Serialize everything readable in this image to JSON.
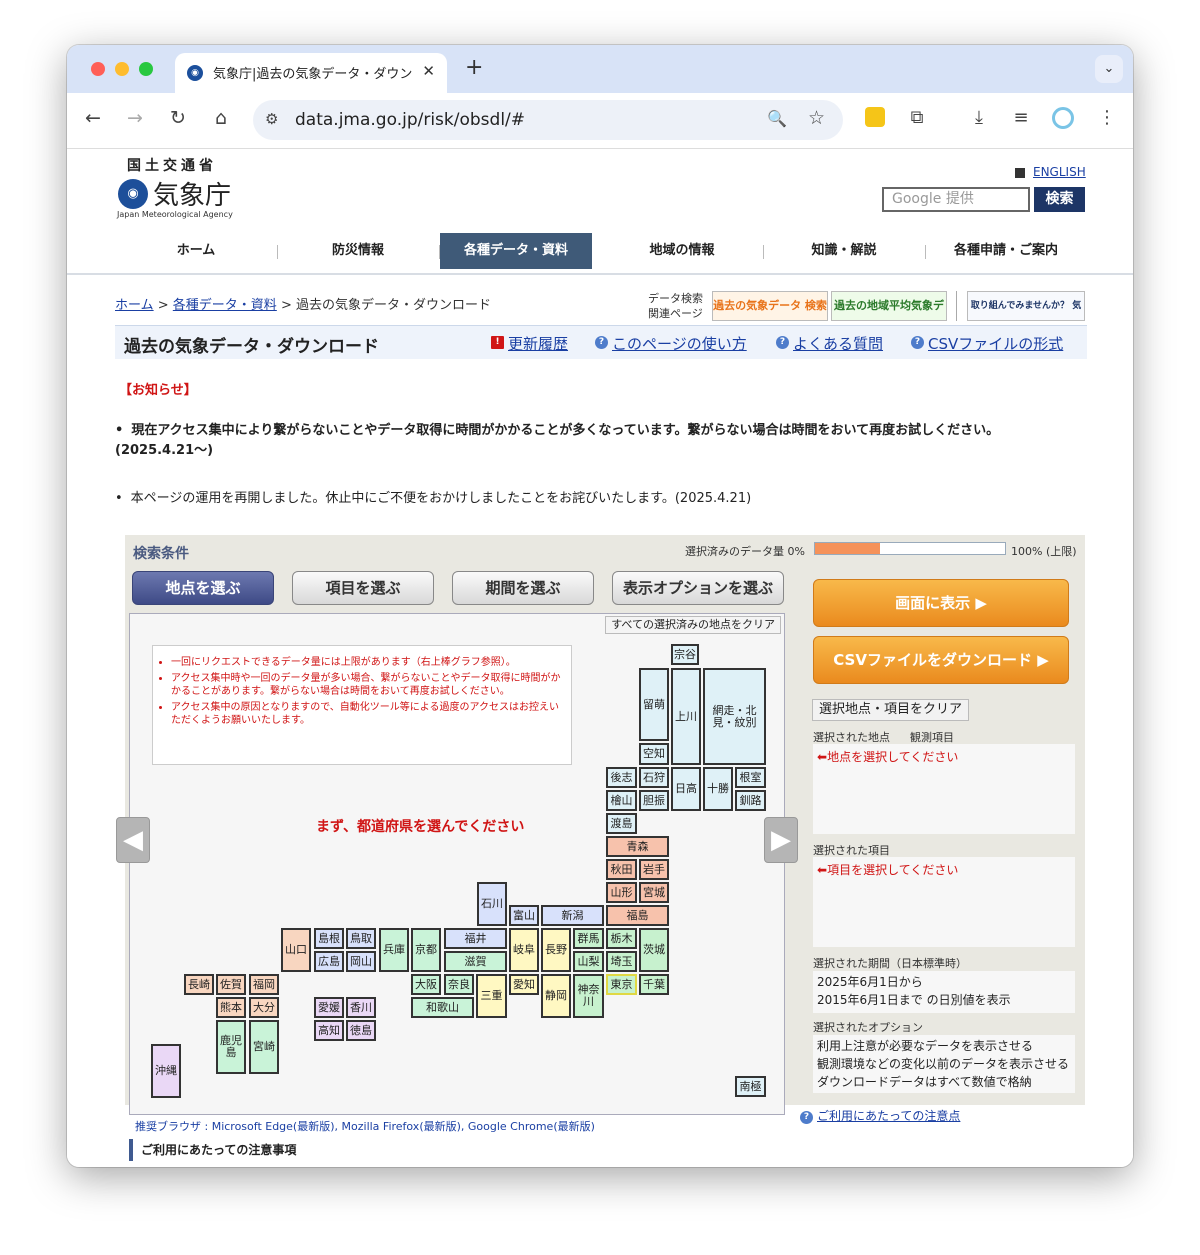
{
  "browser": {
    "tab_title": "気象庁|過去の気象データ・ダウン",
    "tab_close": "✕",
    "new_tab": "+",
    "url": "data.jma.go.jp/risk/obsdl/#"
  },
  "header": {
    "ministry": "国土交通省",
    "agency": "気象庁",
    "agency_en": "Japan Meteorological Agency",
    "english": "ENGLISH",
    "search_placeholder": "Google 提供",
    "search_button": "検索"
  },
  "nav": [
    "ホーム",
    "防災情報",
    "各種データ・資料",
    "地域の情報",
    "知識・解説",
    "各種申請・ご案内"
  ],
  "breadcrumb": {
    "home": "ホーム",
    "data": "各種データ・資料",
    "sep": " > ",
    "current": "過去の気象データ・ダウンロード"
  },
  "related": {
    "label1": "データ検索",
    "label2": "関連ページ",
    "banner1": "過去の気象データ 検索",
    "banner2": "過去の地域平均気象データ 検索",
    "banner3": "取り組んでみませんか？ 気候リスク管理"
  },
  "title": {
    "text": "過去の気象データ・ダウンロード",
    "links": [
      "更新履歴",
      "このページの使い方",
      "よくある質問",
      "CSVファイルの形式"
    ]
  },
  "notice": {
    "heading": "【お知らせ】",
    "item1": "現在アクセス集中により繋がらないことやデータ取得に時間がかかることが多くなっています。繋がらない場合は時間をおいて再度お試しください。(2025.4.21〜)",
    "item2": "本ページの運用を再開しました。休止中にご不便をおかけしましたことをお詫びいたします。(2025.4.21)"
  },
  "search": {
    "title": "検索条件",
    "data_label": "選択済みのデータ量 0%",
    "data_max": "100% (上限)",
    "data_fraction": 0.34,
    "tabs": [
      "地点を選ぶ",
      "項目を選ぶ",
      "期間を選ぶ",
      "表示オプションを選ぶ"
    ],
    "clear_all": "すべての選択済みの地点をクリア",
    "warnings": [
      "一回にリクエストできるデータ量には上限があります（右上棒グラフ参照）。",
      "アクセス集中時や一回のデータ量が多い場合、繋がらないことやデータ取得に時間がかかることがあります。繋がらない場合は時間をおいて再度お試しください。",
      "アクセス集中の原因となりますので、自動化ツール等による過度のアクセスはお控えいただくようお願いいたします。"
    ],
    "choose_prompt": "まず、都道府県を選んでください",
    "prefectures": [
      "宗谷",
      "留萌",
      "上川",
      "網走・北見・紋別",
      "空知",
      "後志",
      "石狩",
      "日高",
      "十勝",
      "根室",
      "檜山",
      "胆振",
      "釧路",
      "渡島",
      "青森",
      "秋田",
      "岩手",
      "山形",
      "宮城",
      "石川",
      "富山",
      "新潟",
      "福島",
      "山口",
      "島根",
      "鳥取",
      "兵庫",
      "京都",
      "福井",
      "岐阜",
      "長野",
      "群馬",
      "栃木",
      "茨城",
      "広島",
      "岡山",
      "滋賀",
      "山梨",
      "埼玉",
      "長崎",
      "佐賀",
      "福岡",
      "大阪",
      "奈良",
      "愛知",
      "東京",
      "千葉",
      "熊本",
      "大分",
      "三重",
      "静岡",
      "神奈川",
      "愛媛",
      "香川",
      "和歌山",
      "高知",
      "徳島",
      "鹿児島",
      "宮崎",
      "沖縄",
      "南極"
    ],
    "arrow_left": "◀",
    "arrow_right": "▶",
    "show_button": "画面に表示",
    "csv_button": "CSVファイルをダウンロード",
    "clear_selection": "選択地点・項目をクリア",
    "selected_points_label": "選択された地点",
    "observed_items_label": "観測項目",
    "points_prompt": "地点を選択してください",
    "selected_items_label": "選択された項目",
    "items_prompt": "項目を選択してください",
    "period_label": "選択された期間（日本標準時）",
    "period_line1": "2025年6月1日から",
    "period_line2": "2015年6月1日まで の日別値を表示",
    "options_label": "選択されたオプション",
    "option1": "利用上注意が必要なデータを表示させる",
    "option2": "観測環境などの変化以前のデータを表示させる",
    "option3": "ダウンロードデータはすべて数値で格納"
  },
  "footer": {
    "notes_link": "ご利用にあたっての注意点",
    "browsers": "推奨ブラウザ : Microsoft Edge(最新版), Mozilla Firefox(最新版), Google Chrome(最新版)",
    "notes_heading": "ご利用にあたっての注意事項"
  },
  "colors": {
    "accent": "#3f5a78",
    "tab_active": "#4a5590",
    "alert": "#d01515",
    "link": "#1a3fa3"
  }
}
